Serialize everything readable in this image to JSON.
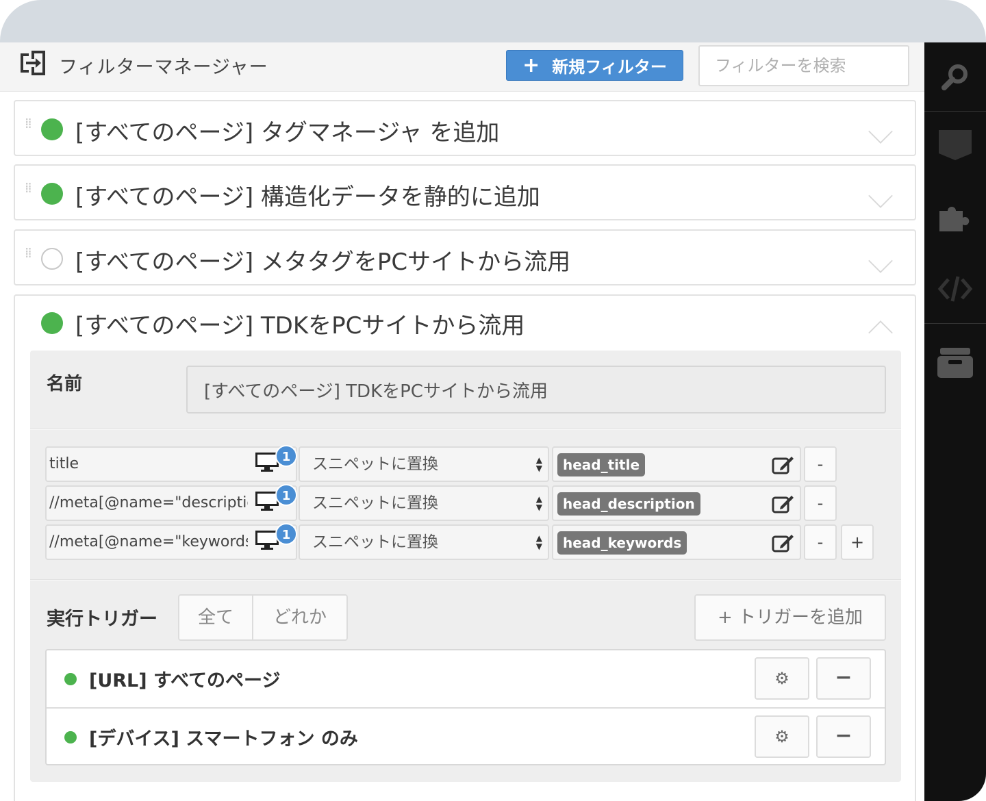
{
  "header": {
    "title": "フィルターマネージャー",
    "new_filter_label": "新規フィルター",
    "search_placeholder": "フィルターを検索"
  },
  "filters": [
    {
      "title": "[すべてのページ] タグマネージャ を追加",
      "enabled": true,
      "expanded": false
    },
    {
      "title": "[すべてのページ] 構造化データを静的に追加",
      "enabled": true,
      "expanded": false
    },
    {
      "title": "[すべてのページ] メタタグをPCサイトから流用",
      "enabled": false,
      "expanded": false
    },
    {
      "title": "[すべてのページ] TDKをPCサイトから流用",
      "enabled": true,
      "expanded": true
    }
  ],
  "editor": {
    "name_label": "名前",
    "name_value": "[すべてのページ] TDKをPCサイトから流用",
    "rules": [
      {
        "xpath": "title",
        "badge": "1",
        "action": "スニペットに置換",
        "snippet": "head_title",
        "remove": "-"
      },
      {
        "xpath": "//meta[@name=\"description\"]",
        "badge": "1",
        "action": "スニペットに置換",
        "snippet": "head_description",
        "remove": "-"
      },
      {
        "xpath": "//meta[@name=\"keywords\"]",
        "badge": "1",
        "action": "スニペットに置換",
        "snippet": "head_keywords",
        "remove": "-",
        "add": "+"
      }
    ],
    "trigger_label": "実行トリガー",
    "match_all": "全て",
    "match_any": "どれか",
    "add_trigger": "+ トリガーを追加",
    "triggers": [
      {
        "text": "[URL] すべてのページ",
        "remove": "−"
      },
      {
        "text": "[デバイス] スマートフォン のみ",
        "remove": "−"
      }
    ]
  },
  "sidebar_icons": [
    "search-icon",
    "css-icon",
    "puzzle-icon",
    "code-icon",
    "archive-icon"
  ],
  "colors": {
    "accent": "#4a8ed4",
    "enabled": "#4cb34e",
    "sidebar": "#111111"
  }
}
